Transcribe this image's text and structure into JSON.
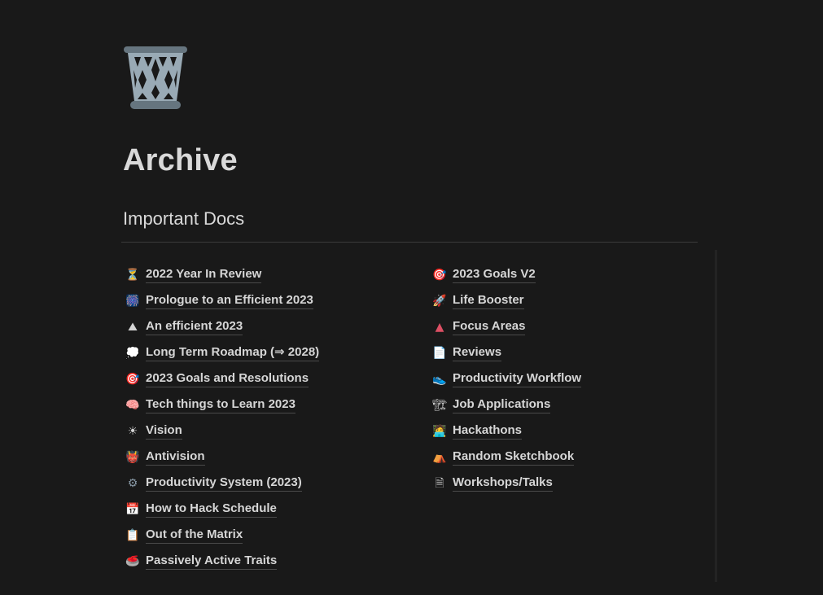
{
  "page": {
    "icon": "wastebasket-icon",
    "title": "Archive",
    "section_heading": "Important Docs"
  },
  "colors": {
    "background": "#191919",
    "text": "#d6d6d6",
    "divider": "#3a3a3a",
    "underline": "#4a4a4a"
  },
  "left_column": [
    {
      "icon": "hourglass-icon",
      "emoji": "⏳",
      "label": "2022 Year In Review"
    },
    {
      "icon": "fireworks-icon",
      "emoji": "🎆",
      "label": "Prologue to an Efficient 2023"
    },
    {
      "icon": "mountain-icon",
      "emoji": "⛰",
      "label": "An efficient 2023"
    },
    {
      "icon": "thought-balloon-icon",
      "emoji": "💭",
      "label": "Long Term Roadmap (⇒ 2028)"
    },
    {
      "icon": "target-icon",
      "emoji": "🎯",
      "label": "2023 Goals and Resolutions"
    },
    {
      "icon": "brain-icon",
      "emoji": "🧠",
      "label": "Tech things to Learn 2023"
    },
    {
      "icon": "sun-icon",
      "emoji": "☀",
      "label": "Vision"
    },
    {
      "icon": "ogre-icon",
      "emoji": "👹",
      "label": "Antivision"
    },
    {
      "icon": "gear-icon",
      "emoji": "⚙",
      "label": "Productivity System (2023)"
    },
    {
      "icon": "calendar-icon",
      "emoji": "📅",
      "label": "How to Hack Schedule"
    },
    {
      "icon": "clipboard-icon",
      "emoji": "📋",
      "label": "Out of the Matrix"
    },
    {
      "icon": "curling-stone-icon",
      "emoji": "🥌",
      "label": "Passively Active Traits"
    }
  ],
  "right_column": [
    {
      "icon": "target-icon",
      "emoji": "🎯",
      "label": "2023 Goals V2"
    },
    {
      "icon": "rocket-icon",
      "emoji": "🚀",
      "label": "Life Booster"
    },
    {
      "icon": "triangle-icon",
      "emoji": "▲",
      "label": "Focus Areas"
    },
    {
      "icon": "page-icon",
      "emoji": "📄",
      "label": "Reviews"
    },
    {
      "icon": "sneaker-icon",
      "emoji": "👟",
      "label": "Productivity Workflow"
    },
    {
      "icon": "crane-icon",
      "emoji": "🏗",
      "label": "Job Applications"
    },
    {
      "icon": "technologist-icon",
      "emoji": "🧑‍💻",
      "label": "Hackathons"
    },
    {
      "icon": "tent-icon",
      "emoji": "⛺",
      "label": "Random Sketchbook"
    },
    {
      "icon": "document-icon",
      "emoji": "🗎",
      "label": "Workshops/Talks"
    }
  ]
}
